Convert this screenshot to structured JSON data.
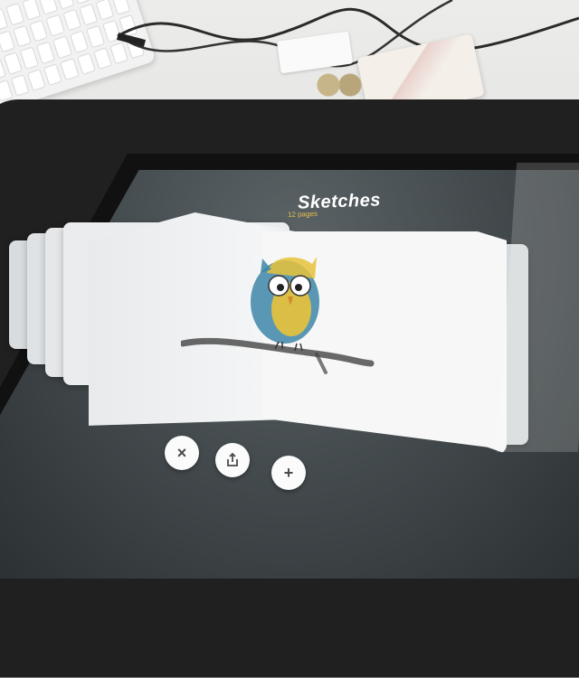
{
  "album": {
    "title": "Sketches",
    "subtitle": "12 pages"
  },
  "controls": {
    "close_icon": "×",
    "share_icon": "share-icon",
    "add_icon": "+"
  },
  "colors": {
    "screen_bg": "#454c4f",
    "subtitle": "#e3c04b",
    "owl_blue": "#3e86a8",
    "owl_yellow": "#e8c23a"
  }
}
